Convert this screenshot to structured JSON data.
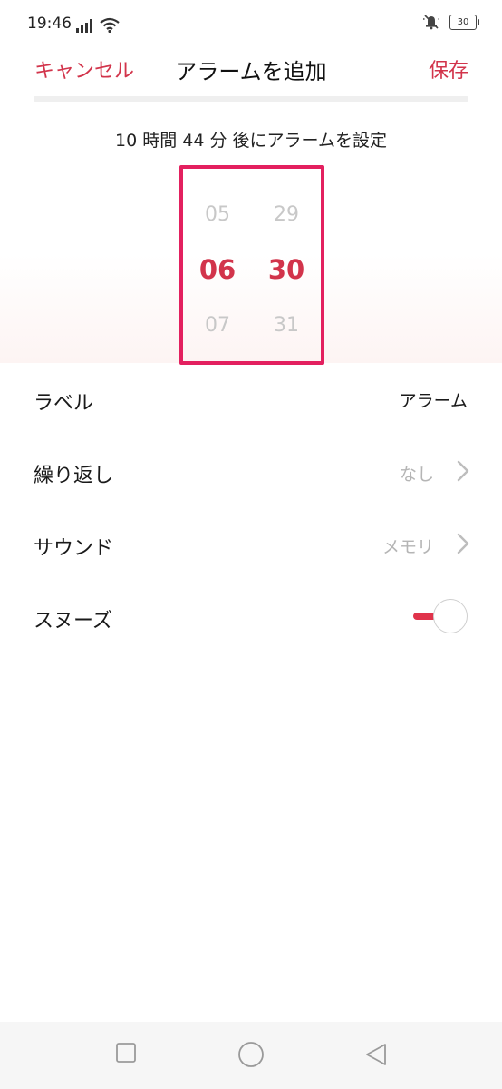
{
  "status_bar": {
    "time": "19:46",
    "battery": "30",
    "icons": [
      "signal-icon",
      "wifi-icon",
      "bell-muted-icon",
      "battery-icon"
    ]
  },
  "header": {
    "cancel_label": "キャンセル",
    "title": "アラームを追加",
    "save_label": "保存"
  },
  "subtitle": "10 時間 44 分 後にアラームを設定",
  "picker": {
    "hours": {
      "prev": "05",
      "current": "06",
      "next": "07"
    },
    "minutes": {
      "prev": "29",
      "current": "30",
      "next": "31"
    }
  },
  "settings": {
    "label": {
      "title": "ラベル",
      "value": "アラーム"
    },
    "repeat": {
      "title": "繰り返し",
      "value": "なし"
    },
    "sound": {
      "title": "サウンド",
      "value": "メモリ"
    },
    "snooze": {
      "title": "スヌーズ",
      "enabled": true
    }
  },
  "colors": {
    "accent": "#d2344b",
    "highlight_border": "#e3205f",
    "muted_text": "#b5b5b5"
  },
  "nav_bar": {
    "icons": [
      "square-icon",
      "circle-icon",
      "back-triangle-icon"
    ]
  }
}
